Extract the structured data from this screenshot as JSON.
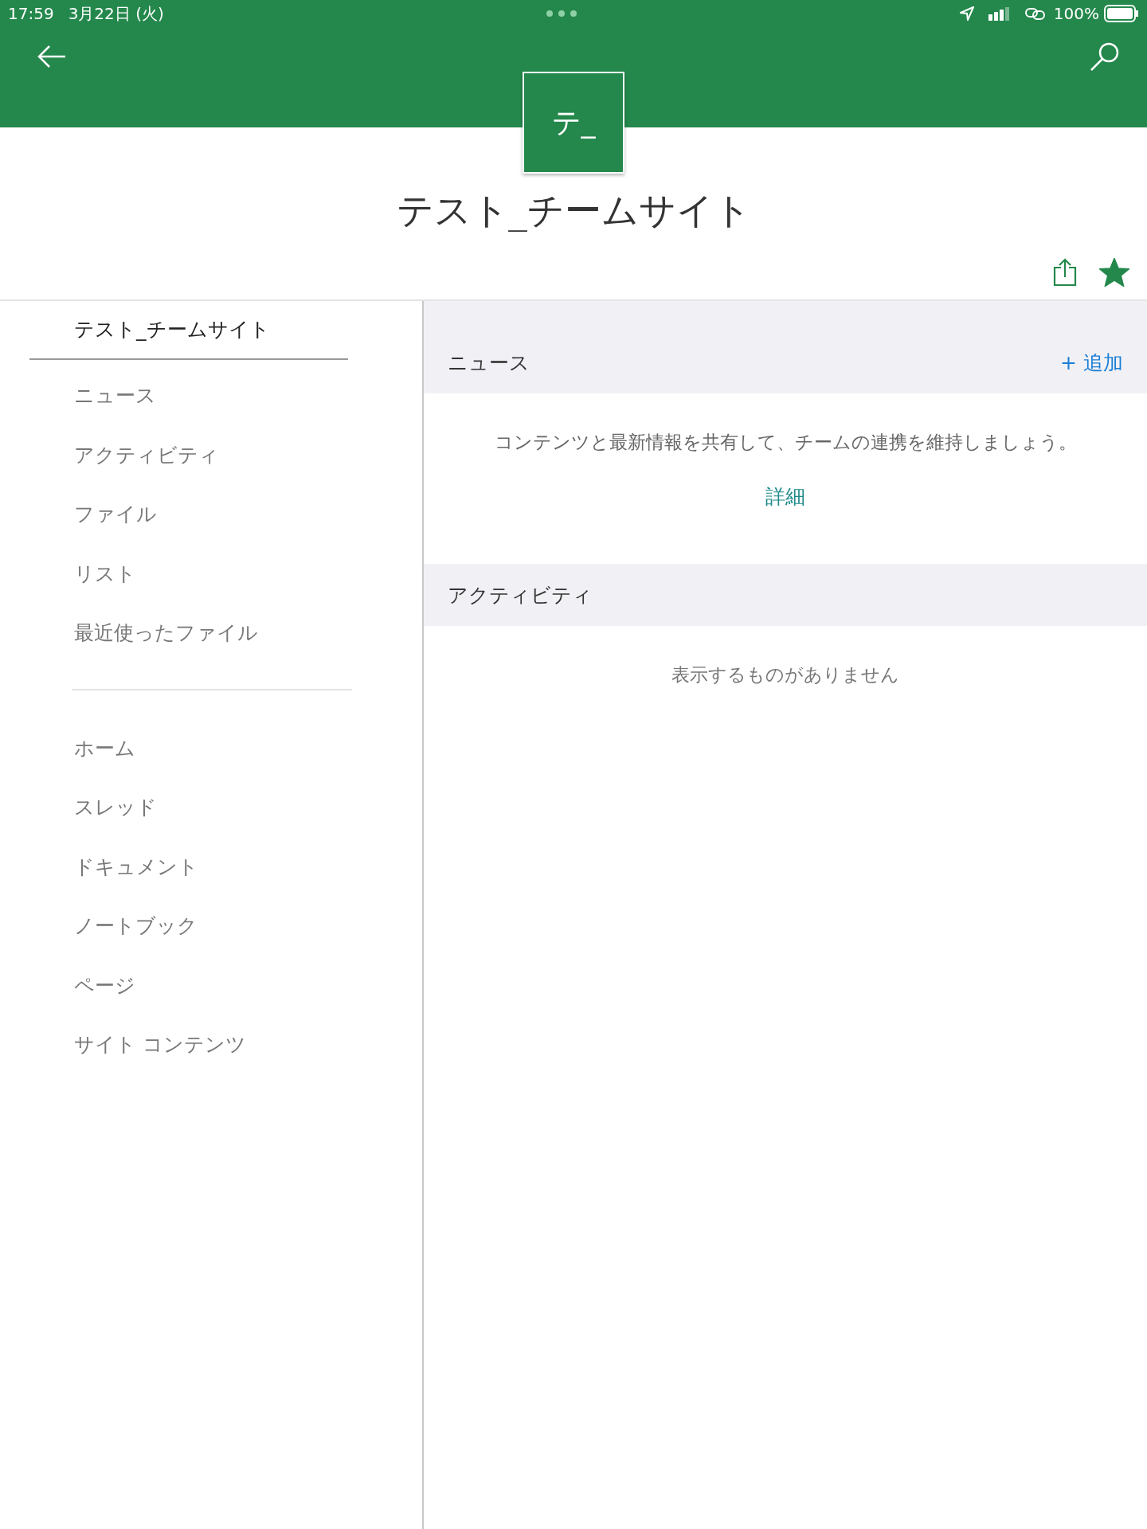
{
  "status_bar": {
    "time": "17:59",
    "date": "3月22日 (火)",
    "battery": "100%"
  },
  "site": {
    "tile": "テ_",
    "title": "テスト_チームサイト",
    "favorite": true
  },
  "sidebar": {
    "groups": [
      {
        "items": [
          {
            "label": "テスト_チームサイト",
            "selected": true
          },
          {
            "label": "ニュース",
            "selected": false
          },
          {
            "label": "アクティビティ",
            "selected": false
          },
          {
            "label": "ファイル",
            "selected": false
          },
          {
            "label": "リスト",
            "selected": false
          },
          {
            "label": "最近使ったファイル",
            "selected": false
          }
        ]
      },
      {
        "items": [
          {
            "label": "ホーム",
            "selected": false
          },
          {
            "label": "スレッド",
            "selected": false
          },
          {
            "label": "ドキュメント",
            "selected": false
          },
          {
            "label": "ノートブック",
            "selected": false
          },
          {
            "label": "ページ",
            "selected": false
          },
          {
            "label": "サイト コンテンツ",
            "selected": false
          }
        ]
      }
    ]
  },
  "news": {
    "title": "ニュース",
    "add": "+ 追加",
    "message": "コンテンツと最新情報を共有して、チームの連携を維持しましょう。",
    "link": "詳細"
  },
  "activity": {
    "title": "アクティビティ",
    "empty": "表示するものがありません"
  }
}
